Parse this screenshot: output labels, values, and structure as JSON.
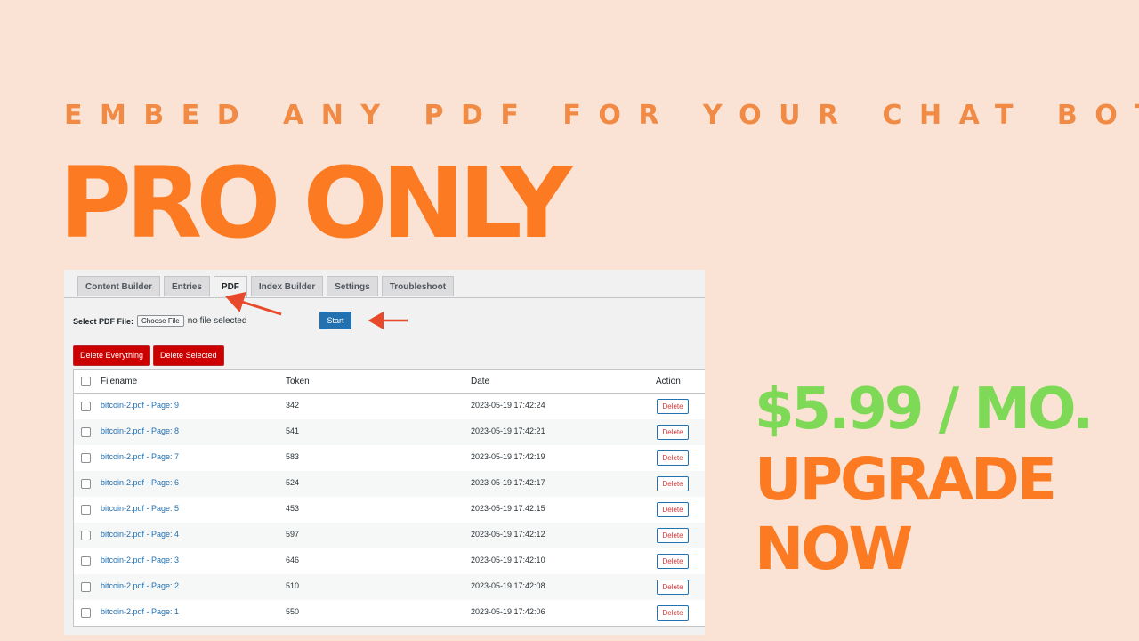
{
  "promo": {
    "tagline": "EMBED ANY PDF FOR YOUR CHAT BOT",
    "headline": "PRO ONLY",
    "price": "$5.99 / MO.",
    "cta_line1": "UPGRADE",
    "cta_line2": "NOW"
  },
  "tabs": [
    {
      "label": "Content Builder"
    },
    {
      "label": "Entries"
    },
    {
      "label": "PDF"
    },
    {
      "label": "Index Builder"
    },
    {
      "label": "Settings"
    },
    {
      "label": "Troubleshoot"
    }
  ],
  "active_tab": "PDF",
  "upload": {
    "label": "Select PDF File:",
    "choose_label": "Choose File",
    "no_file_text": "no file selected",
    "start_label": "Start"
  },
  "bulk": {
    "delete_everything": "Delete Everything",
    "delete_selected": "Delete Selected"
  },
  "table": {
    "headers": {
      "filename": "Filename",
      "token": "Token",
      "date": "Date",
      "action": "Action"
    },
    "delete_label": "Delete",
    "rows": [
      {
        "filename": "bitcoin-2.pdf - Page: 9",
        "token": "342",
        "date": "2023-05-19 17:42:24"
      },
      {
        "filename": "bitcoin-2.pdf - Page: 8",
        "token": "541",
        "date": "2023-05-19 17:42:21"
      },
      {
        "filename": "bitcoin-2.pdf - Page: 7",
        "token": "583",
        "date": "2023-05-19 17:42:19"
      },
      {
        "filename": "bitcoin-2.pdf - Page: 6",
        "token": "524",
        "date": "2023-05-19 17:42:17"
      },
      {
        "filename": "bitcoin-2.pdf - Page: 5",
        "token": "453",
        "date": "2023-05-19 17:42:15"
      },
      {
        "filename": "bitcoin-2.pdf - Page: 4",
        "token": "597",
        "date": "2023-05-19 17:42:12"
      },
      {
        "filename": "bitcoin-2.pdf - Page: 3",
        "token": "646",
        "date": "2023-05-19 17:42:10"
      },
      {
        "filename": "bitcoin-2.pdf - Page: 2",
        "token": "510",
        "date": "2023-05-19 17:42:08"
      },
      {
        "filename": "bitcoin-2.pdf - Page: 1",
        "token": "550",
        "date": "2023-05-19 17:42:06"
      }
    ]
  },
  "colors": {
    "background": "#fae3d4",
    "accent_orange": "#fb7a22",
    "price_green": "#7ed957",
    "wp_blue": "#2271b1",
    "delete_red": "#cc0000",
    "arrow_red": "#e8492a"
  },
  "icons": {
    "annotation": "red-arrow-icon"
  }
}
